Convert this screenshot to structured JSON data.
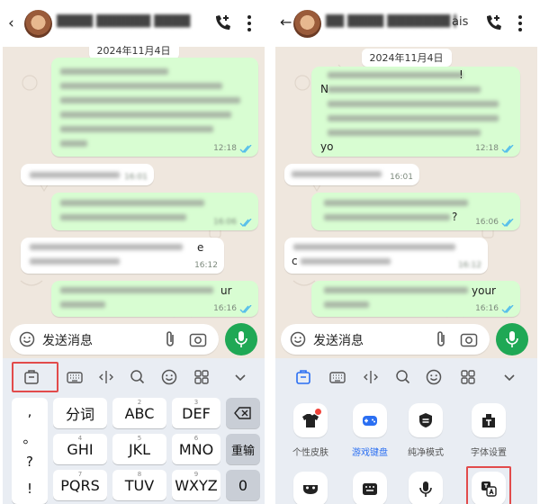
{
  "left": {
    "date": "2024年11月4日",
    "message_times": [
      "12:18",
      "16:01",
      "16:06",
      "16:12",
      "16:16"
    ],
    "clear_fragments": {
      "m4_tail": "e",
      "m5_tail": "ur"
    },
    "composer_placeholder": "发送消息",
    "keyboard": {
      "col_symbols": [
        ",",
        "。",
        "?",
        "!"
      ],
      "row1": [
        {
          "sub": "",
          "label": "分词"
        },
        {
          "sub": "2",
          "label": "ABC"
        },
        {
          "sub": "3",
          "label": "DEF"
        }
      ],
      "row2": [
        {
          "sub": "4",
          "label": "GHI"
        },
        {
          "sub": "5",
          "label": "JKL"
        },
        {
          "sub": "6",
          "label": "MNO"
        }
      ],
      "row3": [
        {
          "sub": "7",
          "label": "PQRS"
        },
        {
          "sub": "8",
          "label": "TUV"
        },
        {
          "sub": "9",
          "label": "WXYZ"
        }
      ],
      "delete_icon": "backspace-icon",
      "retype_label": "重输",
      "zero_label": "0"
    }
  },
  "right": {
    "contact_tail": "ais",
    "date": "2024年11月4日",
    "message_times": [
      "12:18",
      "16:01",
      "16:06",
      "16:12",
      "16:16"
    ],
    "clear_fragments": {
      "m1_tail": "!",
      "m1_head": "N",
      "m1_last": "yo",
      "m3_tail": "?",
      "m4_head": "c",
      "m5_tail": "your"
    },
    "composer_placeholder": "发送消息",
    "keyboard": {
      "tiles": [
        {
          "label": "个性皮肤",
          "icon": "tshirt-icon",
          "active": false
        },
        {
          "label": "游戏键盘",
          "icon": "gamepad-icon",
          "active": true
        },
        {
          "label": "纯净模式",
          "icon": "shield-icon",
          "active": false
        },
        {
          "label": "字体设置",
          "icon": "font-icon",
          "active": false
        }
      ],
      "row2_icons": [
        "mask-icon",
        "keyboard-icon",
        "mic-icon",
        "translate-icon"
      ]
    }
  },
  "colors": {
    "outgoing_bubble": "#d8fdd2",
    "incoming_bubble": "#ffffff",
    "chat_bg": "#efe7de",
    "accent_green": "#1fa855",
    "read_ticks": "#53bdeb",
    "highlight": "#e24b4b",
    "active_tab": "#2b6ff2"
  }
}
